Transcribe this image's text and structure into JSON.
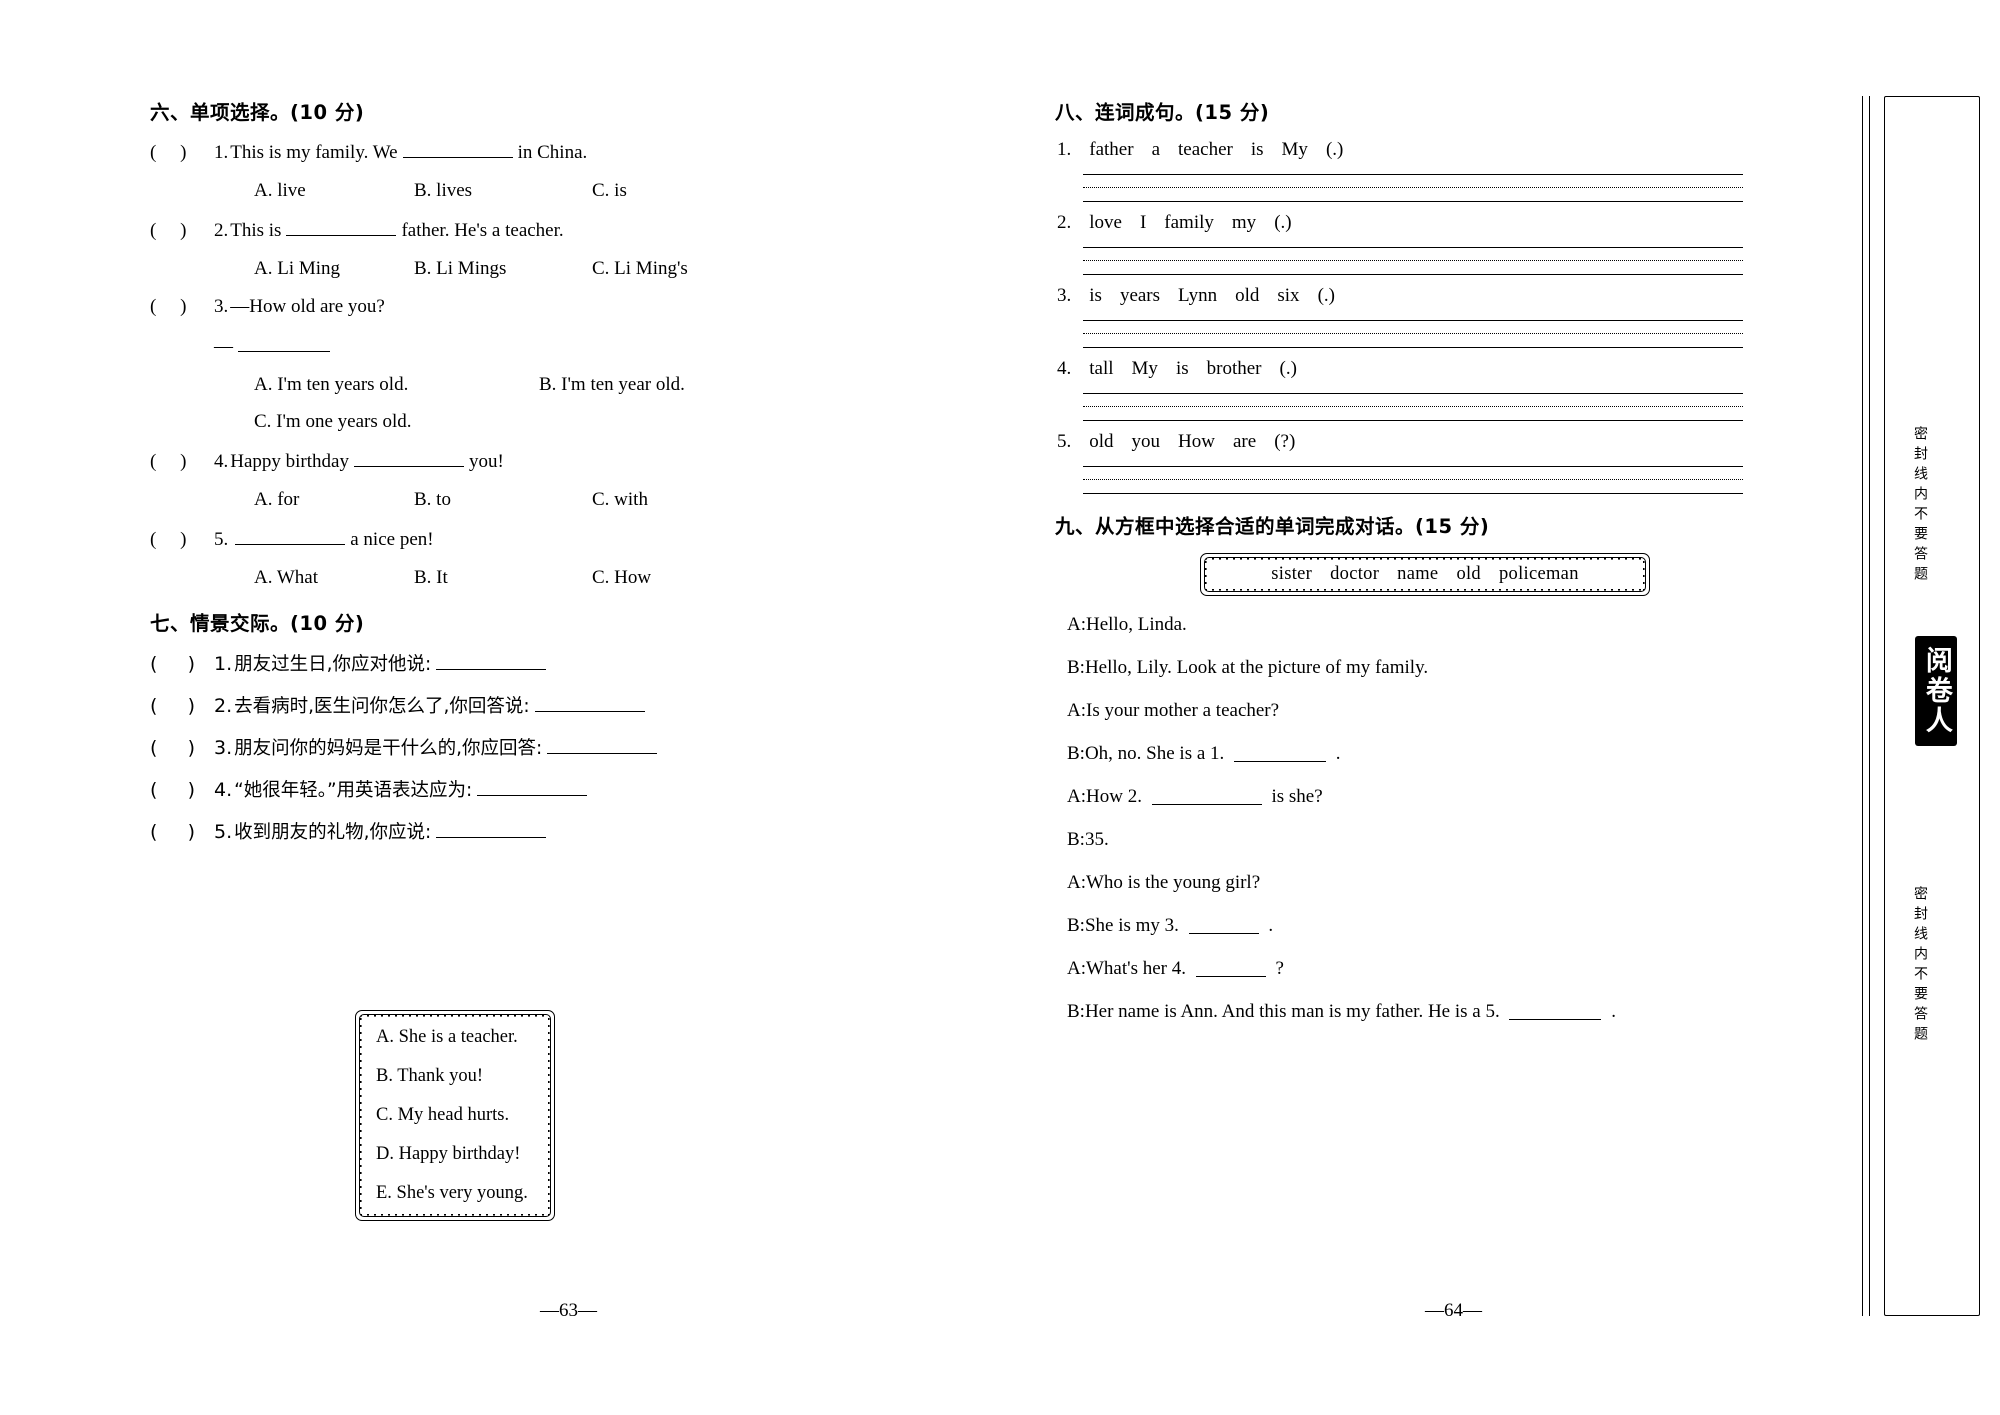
{
  "sections": {
    "six": {
      "heading": "六、单项选择。(10 分)",
      "items": [
        {
          "num": "1.",
          "stem_pre": "This is my family. We",
          "stem_post": "in China.",
          "options": [
            "A. live",
            "B. lives",
            "C. is"
          ]
        },
        {
          "num": "2.",
          "stem_pre": "This is",
          "stem_post": "father. He's a teacher.",
          "options": [
            "A. Li Ming",
            "B. Li Mings",
            "C. Li Ming's"
          ]
        },
        {
          "num": "3.",
          "stem_pre": "—How old are you?",
          "stem_post": "",
          "answer_dash": "—",
          "options": [
            "A. I'm ten years old.",
            "B. I'm ten year old.",
            "C. I'm one years old."
          ]
        },
        {
          "num": "4.",
          "stem_pre": "Happy birthday",
          "stem_post": "you!",
          "options": [
            "A. for",
            "B. to",
            "C. with"
          ]
        },
        {
          "num": "5.",
          "stem_pre": "",
          "stem_post": "a nice pen!",
          "options": [
            "A. What",
            "B. It",
            "C. How"
          ]
        }
      ]
    },
    "seven": {
      "heading": "七、情景交际。(10 分)",
      "items": [
        {
          "num": "1.",
          "text": "朋友过生日,你应对他说:"
        },
        {
          "num": "2.",
          "text": "去看病时,医生问你怎么了,你回答说:"
        },
        {
          "num": "3.",
          "text": "朋友问你的妈妈是干什么的,你应回答:"
        },
        {
          "num": "4.",
          "text": "“她很年轻。”用英语表达应为:"
        },
        {
          "num": "5.",
          "text": "收到朋友的礼物,你应说:"
        }
      ],
      "choice_box": [
        "A. She is a teacher.",
        "B. Thank you!",
        "C. My head hurts.",
        "D. Happy birthday!",
        "E. She's very young."
      ]
    },
    "eight": {
      "heading": "八、连词成句。(15 分)",
      "items": [
        {
          "num": "1.",
          "words": [
            "father",
            "a",
            "teacher",
            "is",
            "My",
            "(.)"
          ]
        },
        {
          "num": "2.",
          "words": [
            "love",
            "I",
            "family",
            "my",
            "(.)"
          ]
        },
        {
          "num": "3.",
          "words": [
            "is",
            "years",
            "Lynn",
            "old",
            "six",
            "(.)"
          ]
        },
        {
          "num": "4.",
          "words": [
            "tall",
            "My",
            "is",
            "brother",
            "(.)"
          ]
        },
        {
          "num": "5.",
          "words": [
            "old",
            "you",
            "How",
            "are",
            "(?)"
          ]
        }
      ]
    },
    "nine": {
      "heading": "九、从方框中选择合适的单词完成对话。(15 分)",
      "word_bank": [
        "sister",
        "doctor",
        "name",
        "old",
        "policeman"
      ],
      "dialogue": [
        "A:Hello, Linda.",
        "B:Hello, Lily. Look at the picture of my family.",
        "A:Is your mother a teacher?",
        "B:Oh, no. She is a 1.",
        "A:How 2.",
        "B:35.",
        "A:Who is the young girl?",
        "B:She is my 3.",
        "A:What's her 4.",
        "B:Her name is Ann. And this man is my father. He is a 5."
      ],
      "dialogue_tails": [
        "",
        "",
        "",
        ".",
        "is she?",
        "",
        "",
        ".",
        "?",
        "."
      ]
    }
  },
  "page_numbers": {
    "left": "—63—",
    "right": "—64—"
  },
  "binding": {
    "seal_text": "阅卷人",
    "mark_top": "密封线内不要答题",
    "mark_bottom": "密封线内不要答题"
  }
}
